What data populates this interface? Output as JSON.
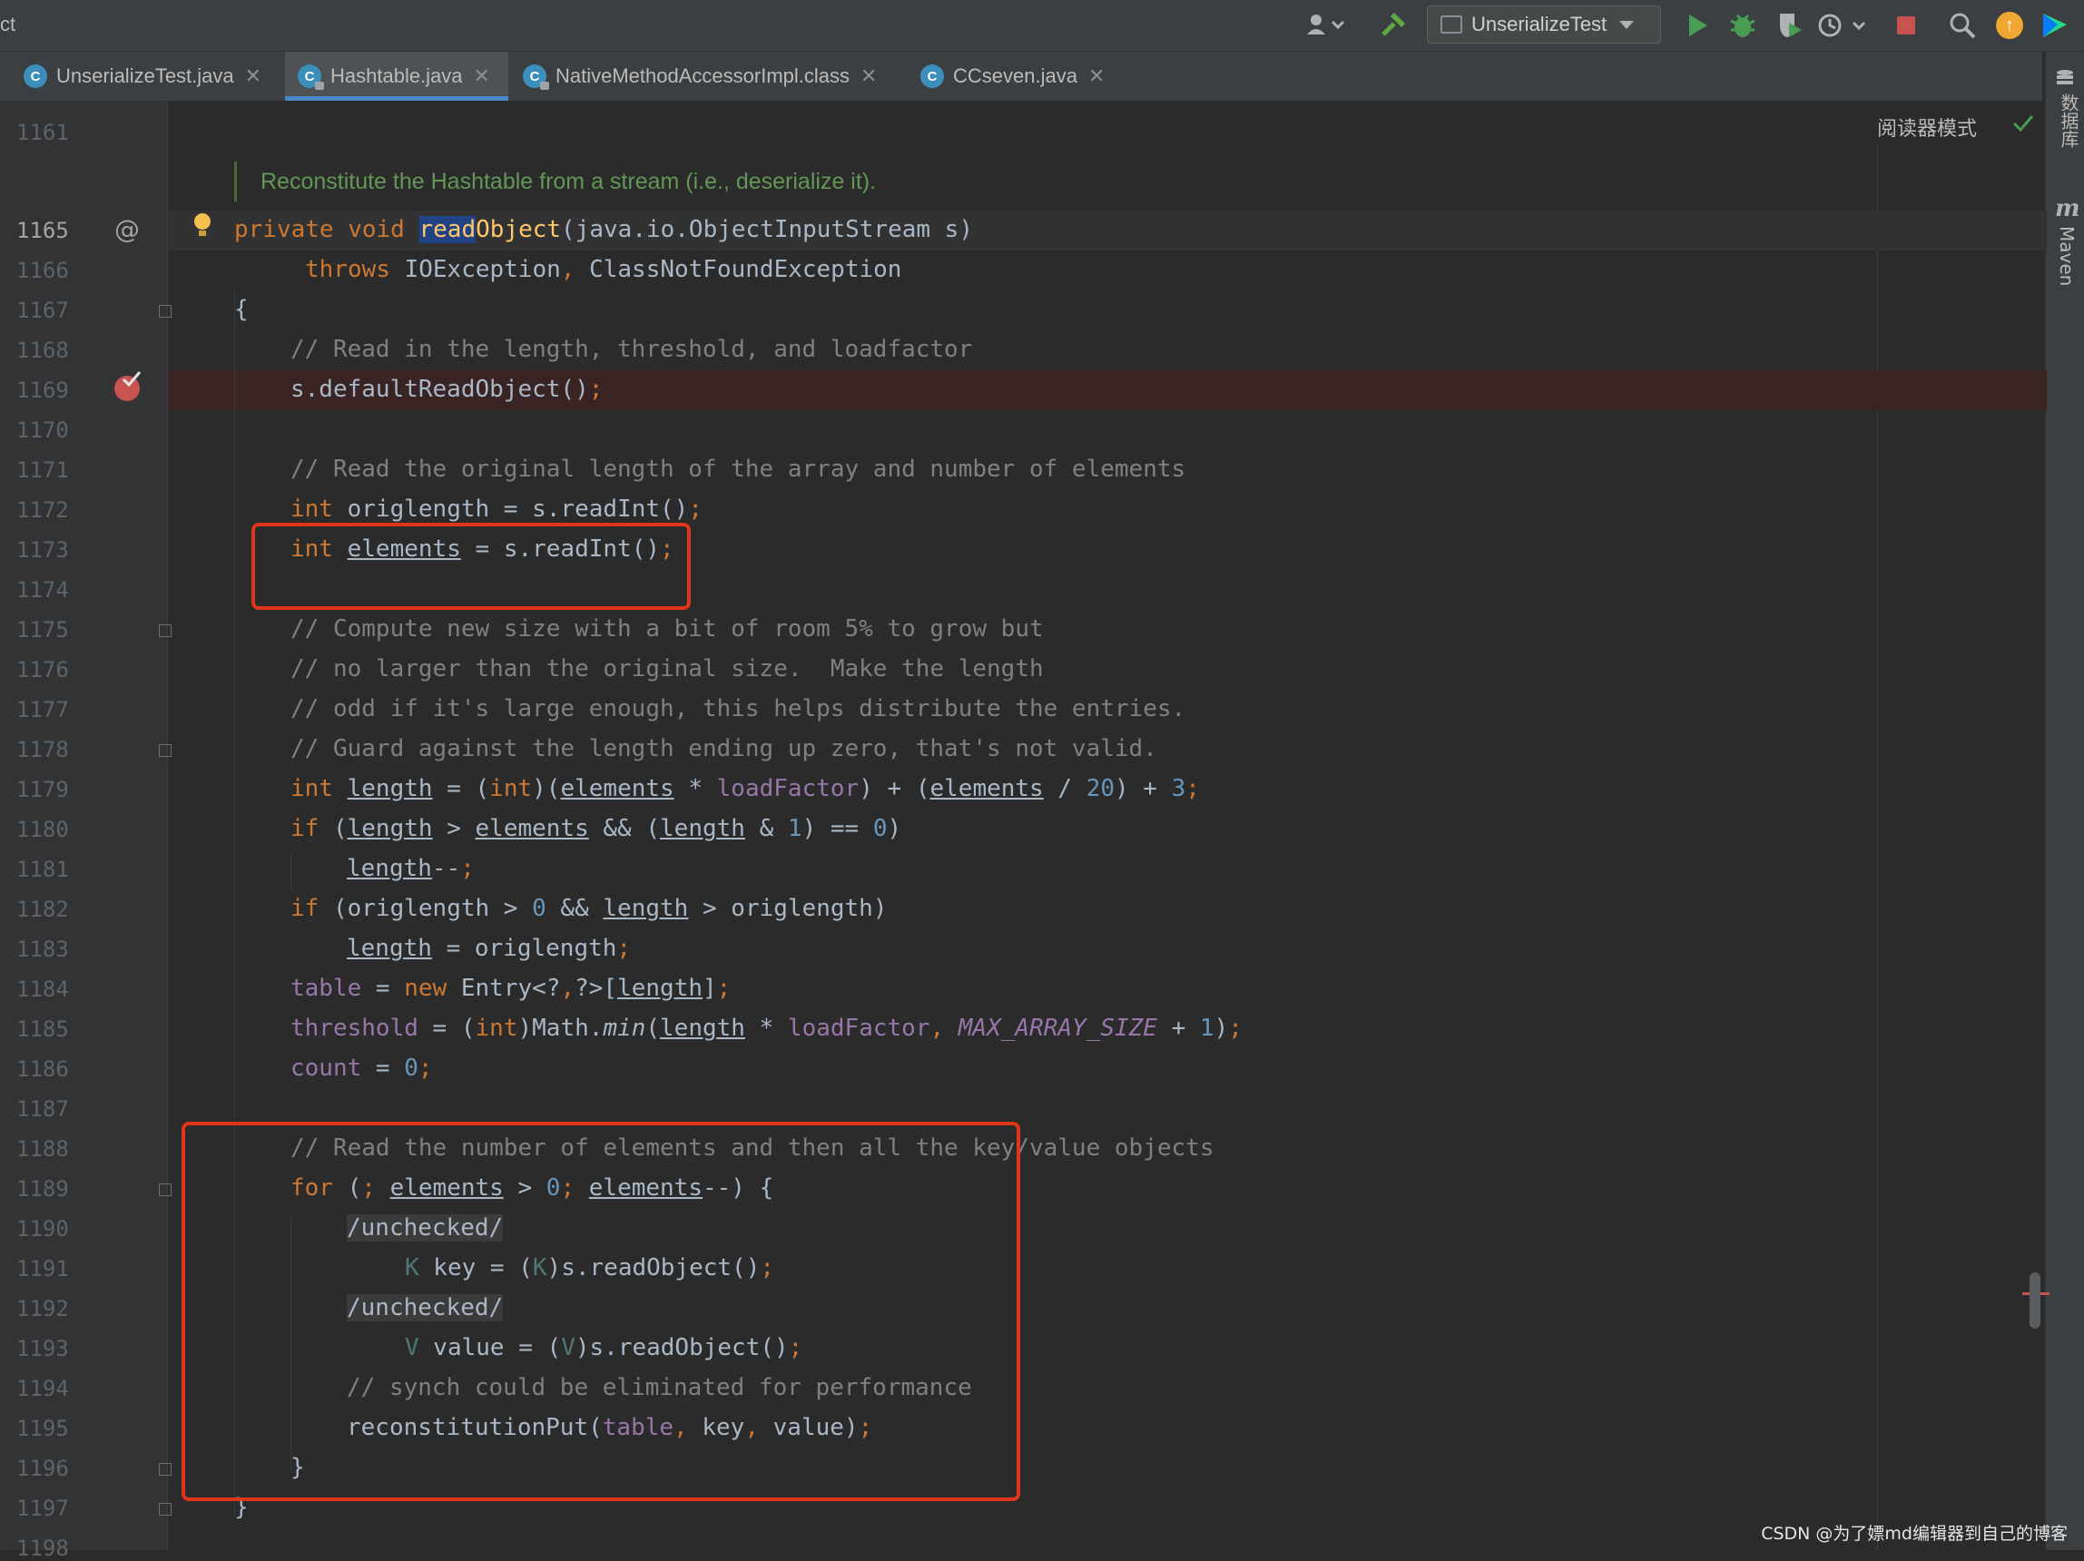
{
  "toolbar": {
    "project_label": "ct",
    "run_config": "UnserializeTest"
  },
  "tabs": [
    {
      "label": "UnserializeTest.java",
      "active": false
    },
    {
      "label": "Hashtable.java",
      "active": true
    },
    {
      "label": "NativeMethodAccessorImpl.class",
      "active": false
    },
    {
      "label": "CCseven.java",
      "active": false
    }
  ],
  "editor": {
    "reader_mode": "阅读器模式",
    "doc_comment": "Reconstitute the Hashtable from a stream (i.e., deserialize it).",
    "line_numbers": [
      "1161",
      "1165",
      "1166",
      "1167",
      "1168",
      "1169",
      "1170",
      "1171",
      "1172",
      "1173",
      "1174",
      "1175",
      "1176",
      "1177",
      "1178",
      "1179",
      "1180",
      "1181",
      "1182",
      "1183",
      "1184",
      "1185",
      "1186",
      "1187",
      "1188",
      "1189",
      "1190",
      "1191",
      "1192",
      "1193",
      "1194",
      "1195",
      "1196",
      "1197",
      "1198"
    ],
    "current_line": "1165",
    "breakpoint_line": "1169",
    "code": {
      "l1165a": "private void ",
      "l1165m1": "read",
      "l1165m2": "Object",
      "l1165b": "(java.io.ObjectInputStream s)",
      "l1166a": "throws",
      "l1166b": " IOException",
      "l1166c": ",",
      "l1166d": " ClassNotFoundException",
      "l1167": "{",
      "l1168": "// Read in the length, threshold, and loadfactor",
      "l1169a": "s.defaultReadObject()",
      "l1169b": ";",
      "l1171": "// Read the original length of the array and number of elements",
      "l1172a": "int",
      "l1172b": " origlength = s.readInt()",
      "l1172c": ";",
      "l1173a": "int",
      "l1173b": "elements",
      "l1173c": " = s.readInt()",
      "l1173d": ";",
      "l1175": "// Compute new size with a bit of room 5% to grow but",
      "l1176": "// no larger than the original size.  Make the length",
      "l1177": "// odd if it's large enough, this helps distribute the entries.",
      "l1178": "// Guard against the length ending up zero, that's not valid.",
      "l1179": {
        "kw1": "int",
        "v1": "length",
        "t1": " = (",
        "kw2": "int",
        "t2": ")(",
        "v2": "elements",
        "t3": " * ",
        "f1": "loadFactor",
        "t4": ") + (",
        "v3": "elements",
        "t5": " / ",
        "n1": "20",
        "t6": ") + ",
        "n2": "3",
        "t7": ";"
      },
      "l1180": {
        "kw1": "if",
        "t1": " (",
        "v1": "length",
        "t2": " > ",
        "v2": "elements",
        "t3": " && (",
        "v3": "length",
        "t4": " & ",
        "n1": "1",
        "t5": ") == ",
        "n2": "0",
        "t6": ")"
      },
      "l1181": {
        "v1": "length",
        "t1": "--",
        "t2": ";"
      },
      "l1182": {
        "kw1": "if",
        "t1": " (origlength > ",
        "n1": "0",
        "t2": " && ",
        "v1": "length",
        "t3": " > origlength)"
      },
      "l1183": {
        "v1": "length",
        "t1": " = origlength",
        "t2": ";"
      },
      "l1184": {
        "f1": "table",
        "t1": " = ",
        "kw1": "new",
        "t2": " Entry<?",
        "t3": ",",
        "t4": "?>[",
        "v1": "length",
        "t5": "]",
        "t6": ";"
      },
      "l1185": {
        "f1": "threshold",
        "t1": " = (",
        "kw1": "int",
        "t2": ")Math.",
        "it1": "min",
        "t3": "(",
        "v1": "length",
        "t4": " * ",
        "f2": "loadFactor",
        "t5": ", ",
        "f3": "MAX_ARRAY_SIZE",
        "t6": " + ",
        "n1": "1",
        "t7": ")",
        "t8": ";"
      },
      "l1186": {
        "f1": "count",
        "t1": " = ",
        "n1": "0",
        "t2": ";"
      },
      "l1188": "// Read the number of elements and then all the key/value objects",
      "l1189": {
        "kw1": "for",
        "t1": " (",
        "t2": ";",
        "t3": " ",
        "v1": "elements",
        "t4": " > ",
        "n1": "0",
        "t5": ";",
        "t6": " ",
        "v2": "elements",
        "t7": "--) {"
      },
      "l1190": "/unchecked/",
      "l1191": {
        "tp1": "K",
        "t1": " key = (",
        "tp2": "K",
        "t2": ")s.readObject()",
        "t3": ";"
      },
      "l1192": "/unchecked/",
      "l1193": {
        "tp1": "V",
        "t1": " value = (",
        "tp2": "V",
        "t2": ")s.readObject()",
        "t3": ";"
      },
      "l1194": "// synch could be eliminated for performance",
      "l1195": {
        "t1": "reconstitutionPut(",
        "f1": "table",
        "t2": ",",
        "t3": " key",
        "t4": ",",
        "t5": " value)",
        "t6": ";"
      },
      "l1196": "}",
      "l1197": "}"
    }
  },
  "side_panels": {
    "database": "数据库",
    "maven": "Maven"
  },
  "watermark": "CSDN @为了嫖md编辑器到自己的博客"
}
